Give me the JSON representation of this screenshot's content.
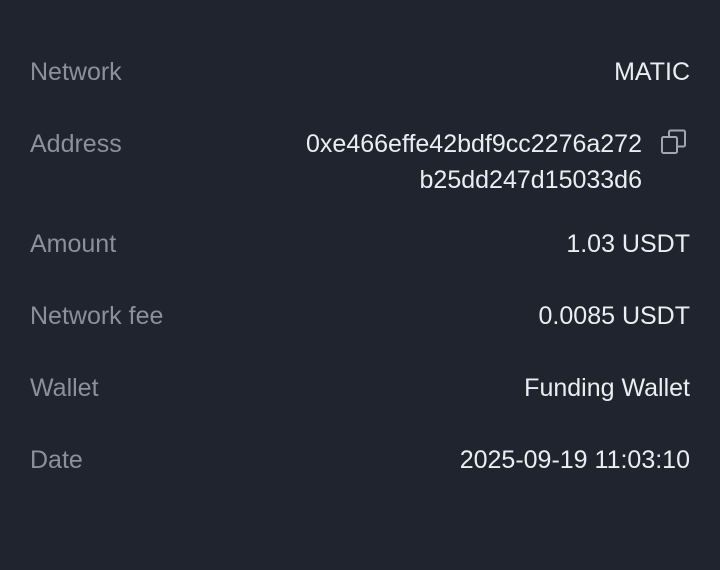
{
  "details": {
    "network": {
      "label": "Network",
      "value": "MATIC"
    },
    "address": {
      "label": "Address",
      "line1": "0xe466effe42bdf9cc2276a272",
      "line2": "b25dd247d15033d6",
      "copy_icon": "copy-icon"
    },
    "amount": {
      "label": "Amount",
      "value": "1.03 USDT"
    },
    "network_fee": {
      "label": "Network fee",
      "value": "0.0085 USDT"
    },
    "wallet": {
      "label": "Wallet",
      "value": "Funding Wallet"
    },
    "date": {
      "label": "Date",
      "value": "2025-09-19 11:03:10"
    }
  },
  "colors": {
    "background": "#1f242e",
    "label": "#8b919c",
    "value": "#ebedf0"
  }
}
